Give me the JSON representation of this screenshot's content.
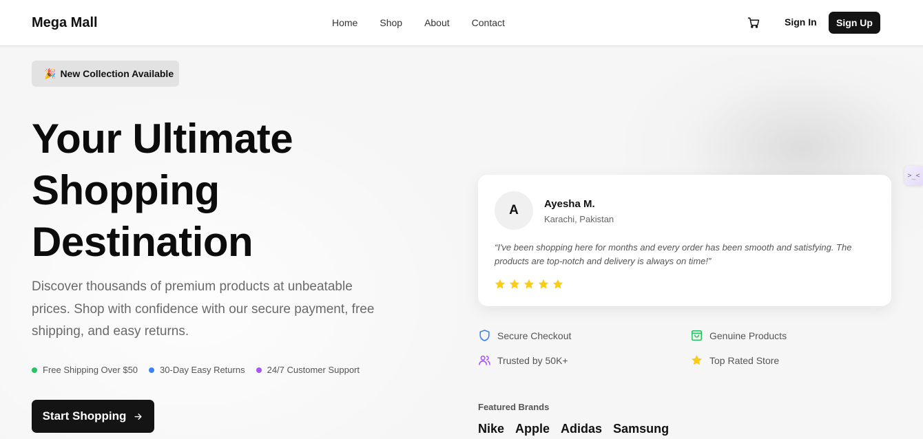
{
  "brand": {
    "name": "Mega Mall"
  },
  "nav": {
    "links": [
      "Home",
      "Shop",
      "About",
      "Contact"
    ],
    "cart_icon": "cart-icon",
    "signin_label": "Sign In",
    "signup_label": "Sign Up"
  },
  "hero": {
    "badge_icon": "🎉",
    "badge_text": "New Collection Available",
    "headline_line1": "Your Ultimate",
    "headline_line2": "Shopping",
    "headline_line3": "Destination",
    "description": "Discover thousands of premium products at unbeatable prices. Shop with confidence with our secure payment, free shipping, and easy returns.",
    "features": [
      {
        "label": "Free Shipping Over $50",
        "color": "#22c55e"
      },
      {
        "label": "30-Day Easy Returns",
        "color": "#3b82f6"
      },
      {
        "label": "24/7 Customer Support",
        "color": "#a855f7"
      }
    ],
    "cta_label": "Start Shopping"
  },
  "review": {
    "initial": "A",
    "name": "Ayesha M.",
    "location": "Karachi, Pakistan",
    "quote": "“I've been shopping here for months and every order has been smooth and satisfying. The products are top-notch and delivery is always on time!”",
    "rating": 5,
    "star_color": "#facc15"
  },
  "trust": {
    "secure": "Secure Checkout",
    "genuine": "Genuine Products",
    "trusted": "Trusted by 50K+",
    "top_rated": "Top Rated Store",
    "colors": {
      "secure": "#3b82f6",
      "genuine": "#22c55e",
      "trusted": "#a855f7",
      "top_rated": "#facc15"
    }
  },
  "brands": {
    "label": "Featured Brands",
    "items": [
      "Nike",
      "Apple",
      "Adidas",
      "Samsung"
    ]
  },
  "side_tab": {
    "text": ">_<"
  }
}
